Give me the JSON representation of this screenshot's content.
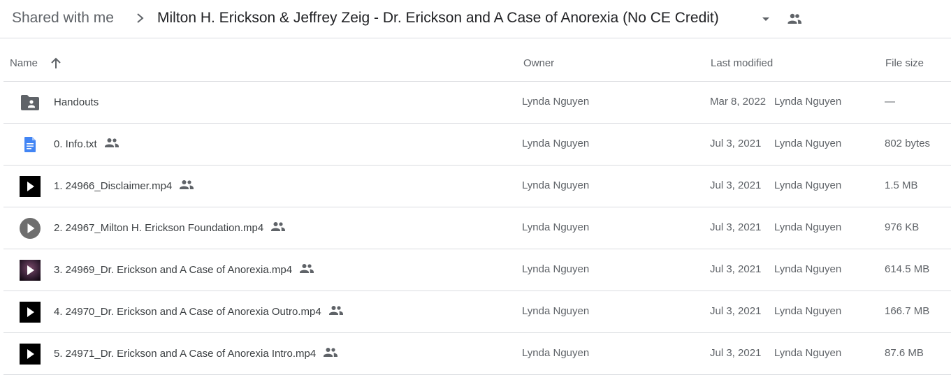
{
  "breadcrumb": {
    "root": "Shared with me",
    "current": "Milton H. Erickson & Jeffrey Zeig - Dr. Erickson and A Case of Anorexia (No CE Credit)"
  },
  "columns": {
    "name": "Name",
    "owner": "Owner",
    "modified": "Last modified",
    "size": "File size"
  },
  "files": [
    {
      "name": "Handouts",
      "icon": "shared-folder-icon",
      "shared": false,
      "owner": "Lynda Nguyen",
      "modified": "Mar 8, 2022",
      "modified_by": "Lynda Nguyen",
      "size": "—"
    },
    {
      "name": "0. Info.txt",
      "icon": "doc-icon",
      "shared": true,
      "owner": "Lynda Nguyen",
      "modified": "Jul 3, 2021",
      "modified_by": "Lynda Nguyen",
      "size": "802 bytes"
    },
    {
      "name": "1. 24966_Disclaimer.mp4",
      "icon": "video-play-icon",
      "shared": true,
      "owner": "Lynda Nguyen",
      "modified": "Jul 3, 2021",
      "modified_by": "Lynda Nguyen",
      "size": "1.5 MB"
    },
    {
      "name": "2. 24967_Milton H. Erickson Foundation.mp4",
      "icon": "video-circle-icon",
      "shared": true,
      "owner": "Lynda Nguyen",
      "modified": "Jul 3, 2021",
      "modified_by": "Lynda Nguyen",
      "size": "976 KB"
    },
    {
      "name": "3.  24969_Dr. Erickson and A Case of Anorexia.mp4",
      "icon": "video-thumbnail-icon",
      "shared": true,
      "owner": "Lynda Nguyen",
      "modified": "Jul 3, 2021",
      "modified_by": "Lynda Nguyen",
      "size": "614.5 MB"
    },
    {
      "name": "4.  24970_Dr. Erickson and A Case of Anorexia Outro.mp4",
      "icon": "video-play-icon",
      "shared": true,
      "owner": "Lynda Nguyen",
      "modified": "Jul 3, 2021",
      "modified_by": "Lynda Nguyen",
      "size": "166.7 MB"
    },
    {
      "name": "5.  24971_Dr. Erickson and A Case of Anorexia Intro.mp4",
      "icon": "video-play-icon",
      "shared": true,
      "owner": "Lynda Nguyen",
      "modified": "Jul 3, 2021",
      "modified_by": "Lynda Nguyen",
      "size": "87.6 MB"
    }
  ],
  "colors": {
    "doc_blue": "#4285f4",
    "icon_grey": "#5f6368",
    "divider": "#dadce0"
  }
}
